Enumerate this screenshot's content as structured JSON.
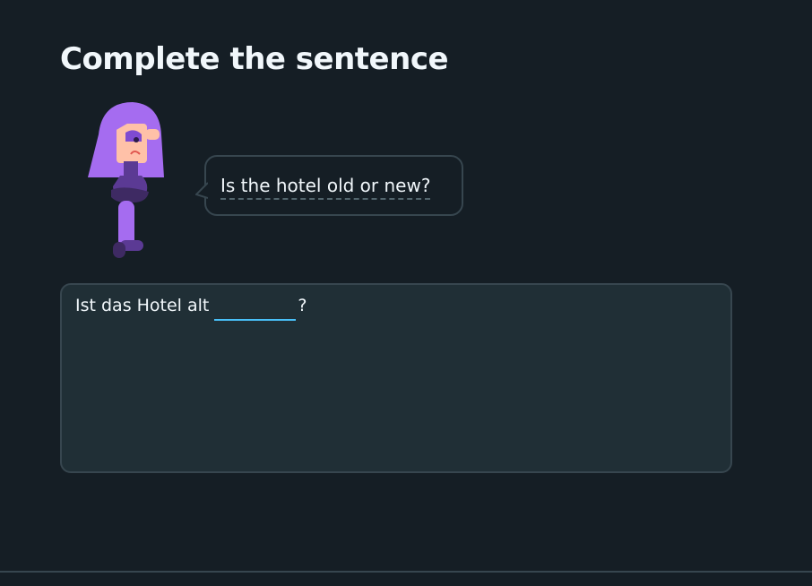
{
  "title": "Complete the sentence",
  "character": {
    "icon": "character-illustration-icon"
  },
  "prompt": {
    "text": "Is the hotel old or new?"
  },
  "answer": {
    "before": "Ist das Hotel alt",
    "input_value": "",
    "after": "?"
  },
  "colors": {
    "background": "#151e25",
    "panel": "#202f36",
    "border": "#37464f",
    "input_underline": "#49c0f8",
    "character_hair": "#a56cf0",
    "character_skin": "#ffc1a8",
    "character_body": "#5b3a94"
  }
}
